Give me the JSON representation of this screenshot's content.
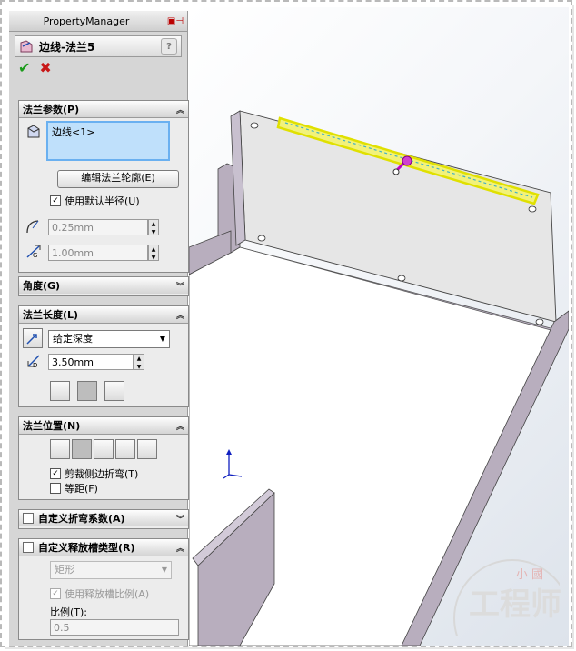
{
  "panel": {
    "title": "PropertyManager",
    "feature_name": "边线-法兰5",
    "help": "?"
  },
  "flange_params": {
    "header": "法兰参数(P)",
    "selection": "边线<1>",
    "edit_profile_button": "编辑法兰轮廓(E)",
    "use_default_radius": "使用默认半径(U)",
    "radius": "0.25mm",
    "gap": "1.00mm",
    "gap_glyph": "G"
  },
  "angle": {
    "header": "角度(G)"
  },
  "flange_length": {
    "header": "法兰长度(L)",
    "end_condition": "给定深度",
    "length": "3.50mm",
    "depth_glyph": "D"
  },
  "flange_position": {
    "header": "法兰位置(N)",
    "trim_side_bends": "剪裁侧边折弯(T)",
    "offset": "等距(F)"
  },
  "custom_bend": {
    "header": "自定义折弯系数(A)"
  },
  "custom_relief": {
    "header": "自定义释放槽类型(R)",
    "type": "矩形",
    "use_ratio": "使用释放槽比例(A)",
    "ratio_label": "比例(T):",
    "ratio": "0.5"
  },
  "watermark": {
    "top": "小 國",
    "bottom": "工程师"
  },
  "colors": {
    "panel": "#d6d6d6",
    "selection": "#bfe0fb",
    "sheet": "#b8aebe",
    "highlight": "#f2f200"
  }
}
